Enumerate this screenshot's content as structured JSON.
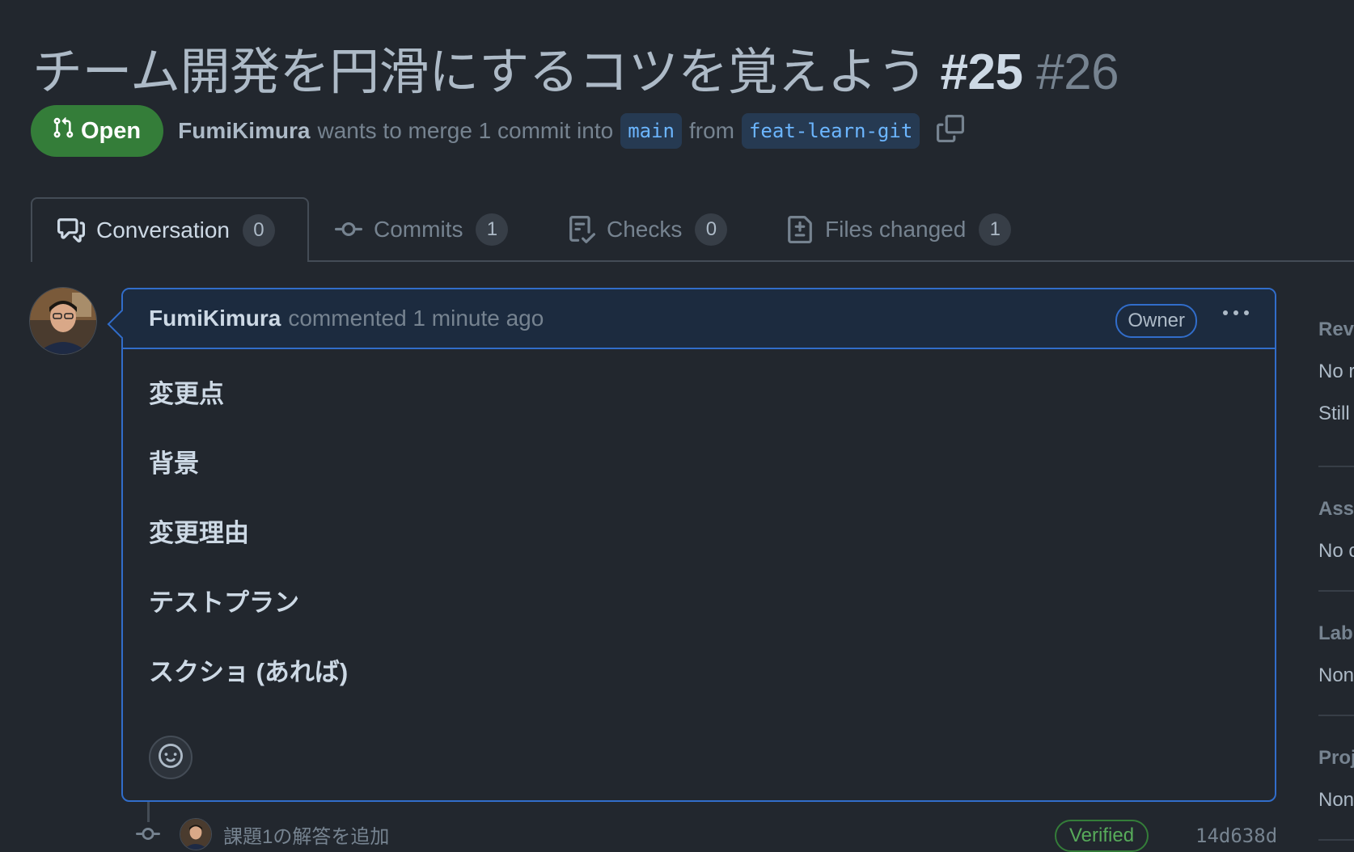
{
  "pr": {
    "title": "チーム開発を円滑にするコツを覚えよう",
    "ref": "#25",
    "number": "#26",
    "state": "Open",
    "author": "FumiKimura",
    "merge_text": "wants to merge 1 commit into",
    "base_branch": "main",
    "from_text": "from",
    "head_branch": "feat-learn-git"
  },
  "tabs": [
    {
      "label": "Conversation",
      "count": "0",
      "icon": "comment-discussion-icon"
    },
    {
      "label": "Commits",
      "count": "1",
      "icon": "git-commit-icon"
    },
    {
      "label": "Checks",
      "count": "0",
      "icon": "checklist-icon"
    },
    {
      "label": "Files changed",
      "count": "1",
      "icon": "file-diff-icon"
    }
  ],
  "comment": {
    "author": "FumiKimura",
    "meta": "commented 1 minute ago",
    "badge": "Owner",
    "headings": [
      "変更点",
      "背景",
      "変更理由",
      "テストプラン",
      "スクショ (あれば)"
    ]
  },
  "commit": {
    "message": "課題1の解答を追加",
    "verified": "Verified",
    "sha": "14d638d"
  },
  "sidebar": {
    "sections": [
      {
        "title": "Rev",
        "values": [
          "No r",
          "Still"
        ]
      },
      {
        "title": "Ass",
        "values": [
          "No c"
        ]
      },
      {
        "title": "Lab",
        "values": [
          "Non"
        ]
      },
      {
        "title": "Proj",
        "values": [
          "Non"
        ]
      }
    ]
  },
  "colors": {
    "background": "#22272e",
    "open_green": "#347d39",
    "accent_blue": "#316dca",
    "branch_text": "#6cb6ff"
  }
}
